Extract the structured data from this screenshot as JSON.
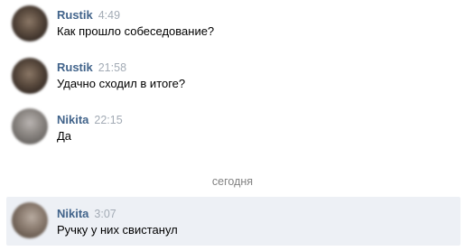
{
  "messages": [
    {
      "author": "Rustik",
      "time": "4:49",
      "text": "Как прошло собеседование?"
    },
    {
      "author": "Rustik",
      "time": "21:58",
      "text": "Удачно сходил в итоге?"
    },
    {
      "author": "Nikita",
      "time": "22:15",
      "text": "Да"
    },
    {
      "author": "Nikita",
      "time": "3:07",
      "text": "Ручку у них свистанул"
    }
  ],
  "date_divider": "сегодня",
  "colors": {
    "author_name": "#42648b",
    "timestamp": "#a3abb5",
    "highlight_bg": "#edf0f5",
    "divider_text": "#828282"
  }
}
